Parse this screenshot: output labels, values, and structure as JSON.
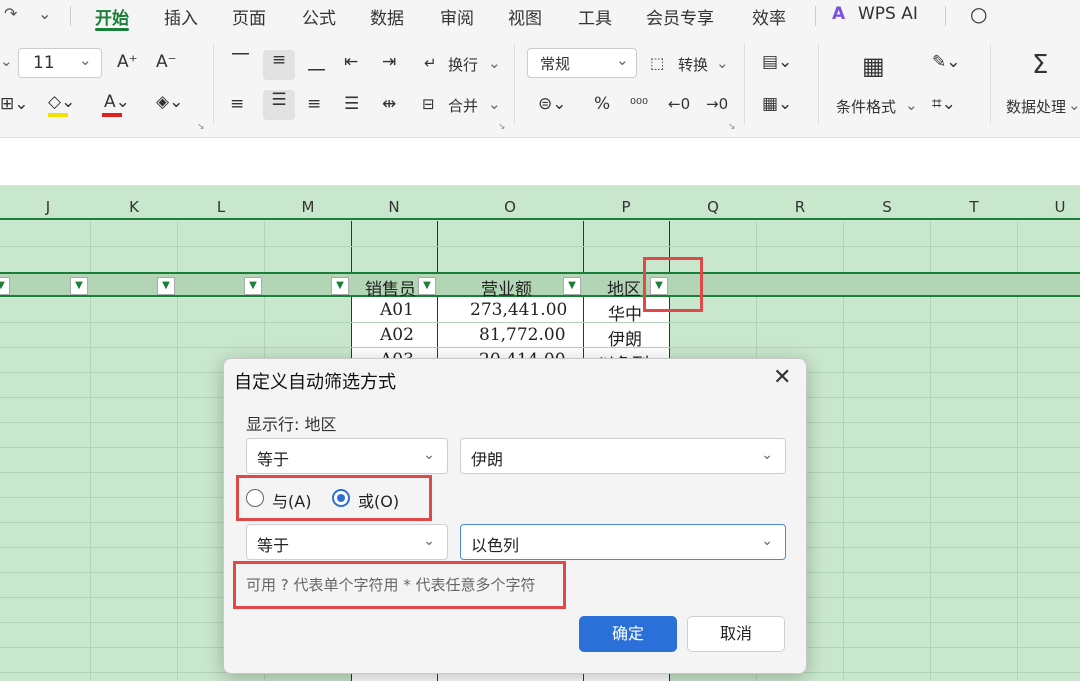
{
  "menu": {
    "tabs": [
      "开始",
      "插入",
      "页面",
      "公式",
      "数据",
      "审阅",
      "视图",
      "工具",
      "会员专享",
      "效率",
      "WPS AI"
    ]
  },
  "ribbon": {
    "font_size": "11",
    "wrap_label": "换行",
    "merge_label": "合并",
    "number_format": "常规",
    "convert_label": "转换",
    "cond_format_label": "条件格式",
    "data_process_label": "数据处理"
  },
  "columns": [
    "J",
    "K",
    "L",
    "M",
    "N",
    "O",
    "P",
    "Q",
    "R",
    "S",
    "T",
    "U"
  ],
  "table": {
    "headers": [
      "销售员",
      "营业额",
      "地区"
    ],
    "rows": [
      [
        "A01",
        "273,441.00",
        "华中"
      ],
      [
        "A02",
        "81,772.00",
        "伊朗"
      ],
      [
        "A03",
        "20,414.00",
        "以色列"
      ]
    ]
  },
  "dialog": {
    "title": "自定义自动筛选方式",
    "show_rows_label": "显示行: 地区",
    "condition1_op": "等于",
    "condition1_value": "伊朗",
    "and_label": "与(A)",
    "or_label": "或(O)",
    "logic_selected": "or",
    "condition2_op": "等于",
    "condition2_value": "以色列",
    "hint": "可用 ? 代表单个字符用 * 代表任意多个字符",
    "ok_label": "确定",
    "cancel_label": "取消"
  },
  "colors": {
    "accent_green": "#1a7f37",
    "sheet_bg": "#c9e7cc",
    "highlight_red": "#e0494a",
    "primary_blue": "#2b6fd8"
  }
}
